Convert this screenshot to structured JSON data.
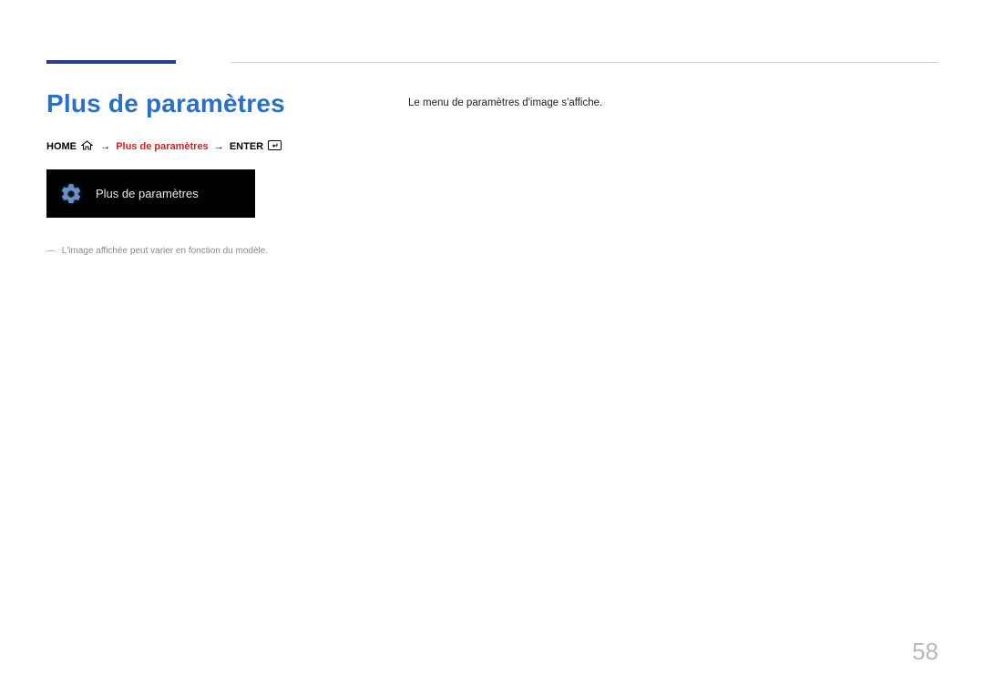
{
  "title": "Plus de paramètres",
  "breadcrumb": {
    "home": "HOME",
    "middle": "Plus de paramètres",
    "enter": "ENTER",
    "arrow": "→"
  },
  "tile": {
    "label": "Plus de paramètres"
  },
  "footnote": {
    "dash": "―",
    "text": "L'image affichée peut varier en fonction du modèle."
  },
  "right_desc": "Le menu de paramètres d'image s'affiche.",
  "page_number": "58"
}
